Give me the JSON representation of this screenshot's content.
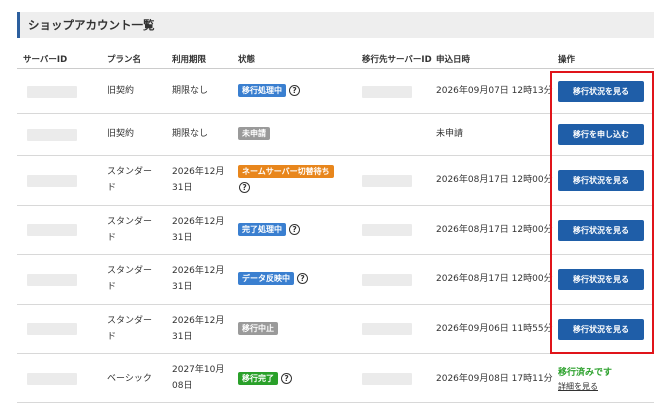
{
  "section": {
    "title": "ショップアカウント一覧"
  },
  "table": {
    "headers": {
      "server_id": "サーバーID",
      "plan": "プラン名",
      "period": "利用期限",
      "status": "状態",
      "target_server": "移行先サーバーID",
      "applied": "申込日時",
      "action": "操作"
    },
    "rows": [
      {
        "plan": "旧契約",
        "period_1": "期限なし",
        "period_2": "",
        "status": "移行処理中",
        "status_color": "#3a7fd0",
        "help": true,
        "target_placeholder": true,
        "applied": "2026年09月07日 12時13分",
        "action": "移行状況を見る"
      },
      {
        "plan": "旧契約",
        "period_1": "期限なし",
        "period_2": "",
        "status": "未申請",
        "status_color": "#9a9a9a",
        "help": false,
        "target_placeholder": false,
        "applied": "未申請",
        "action": "移行を申し込む"
      },
      {
        "plan_1": "スタンダー",
        "plan_2": "ド",
        "period_1": "2026年12月",
        "period_2": "31日",
        "status": "ネームサーバー切替待ち",
        "status_color": "#e8861c",
        "help": true,
        "target_placeholder": true,
        "applied": "2026年08月17日 12時00分",
        "action": "移行状況を見る"
      },
      {
        "plan_1": "スタンダー",
        "plan_2": "ド",
        "period_1": "2026年12月",
        "period_2": "31日",
        "status": "完了処理中",
        "status_color": "#3a7fd0",
        "help": true,
        "target_placeholder": true,
        "applied": "2026年08月17日 12時00分",
        "action": "移行状況を見る"
      },
      {
        "plan_1": "スタンダー",
        "plan_2": "ド",
        "period_1": "2026年12月",
        "period_2": "31日",
        "status": "データ反映中",
        "status_color": "#3a7fd0",
        "help": true,
        "target_placeholder": true,
        "applied": "2026年08月17日 12時00分",
        "action": "移行状況を見る"
      },
      {
        "plan_1": "スタンダー",
        "plan_2": "ド",
        "period_1": "2026年12月",
        "period_2": "31日",
        "status": "移行中止",
        "status_color": "#9a9a9a",
        "help": false,
        "target_placeholder": true,
        "applied": "2026年09月06日 11時55分",
        "action": "移行状況を見る"
      },
      {
        "plan": "ベーシック",
        "period_1": "2027年10月",
        "period_2": "08日",
        "status": "移行完了",
        "status_color": "#2aa02a",
        "help": true,
        "target_placeholder": true,
        "applied": "2026年09月08日 17時11分",
        "migrated_label": "移行済みです",
        "detail_link": "詳細を見る"
      }
    ]
  },
  "icons": {
    "help": "question-circle-icon"
  },
  "colors": {
    "primary_button": "#1f5ea8",
    "highlight_border": "#e0141a",
    "accent_bar": "#2c5f9e"
  }
}
